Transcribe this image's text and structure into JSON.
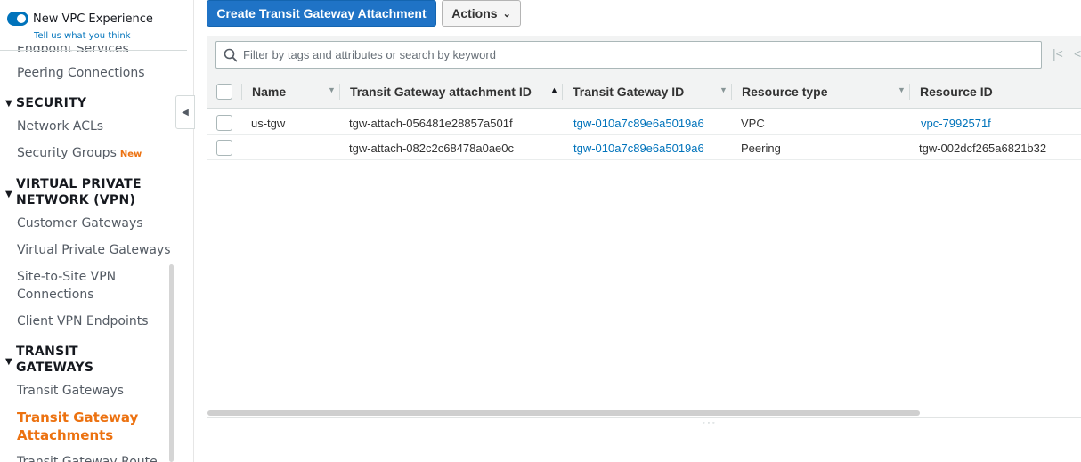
{
  "sidebar": {
    "toggle_label": "New VPC Experience",
    "tell_us": "Tell us what you think",
    "cut_item": "Endpoint Services",
    "peering": "Peering Connections",
    "security": {
      "heading": "SECURITY",
      "items": [
        "Network ACLs",
        "Security Groups"
      ],
      "new_badge": "New"
    },
    "vpn": {
      "heading_line1": "VIRTUAL PRIVATE",
      "heading_line2": "NETWORK (VPN)",
      "items": [
        "Customer Gateways",
        "Virtual Private Gateways",
        "Site-to-Site VPN",
        "Connections",
        "Client VPN Endpoints"
      ]
    },
    "transit": {
      "heading_line1": "TRANSIT",
      "heading_line2": "GATEWAYS",
      "items": [
        "Transit Gateways",
        "Transit Gateway",
        "Attachments",
        "Transit Gateway Route"
      ]
    },
    "collapse_icon": "chevron-left-icon"
  },
  "toolbar": {
    "create_label": "Create Transit Gateway Attachment",
    "actions_label": "Actions"
  },
  "filter": {
    "placeholder": "Filter by tags and attributes or search by keyword"
  },
  "table": {
    "columns": [
      "Name",
      "Transit Gateway attachment ID",
      "Transit Gateway ID",
      "Resource type",
      "Resource ID"
    ],
    "sorted_column": "Transit Gateway attachment ID",
    "sort_direction": "ascending",
    "rows": [
      {
        "name": "us-tgw",
        "attachment_id": "tgw-attach-056481e28857a501f",
        "tgw_id": "tgw-010a7c89e6a5019a6",
        "resource_type": "VPC",
        "resource_id": "vpc-7992571f"
      },
      {
        "name": "",
        "attachment_id": "tgw-attach-082c2c68478a0ae0c",
        "tgw_id": "tgw-010a7c89e6a5019a6",
        "resource_type": "Peering",
        "resource_id": "tgw-002dcf265a6821b32"
      }
    ]
  },
  "colors": {
    "primary": "#1f73c6",
    "link": "#0073bb",
    "active_nav": "#ec7211"
  }
}
